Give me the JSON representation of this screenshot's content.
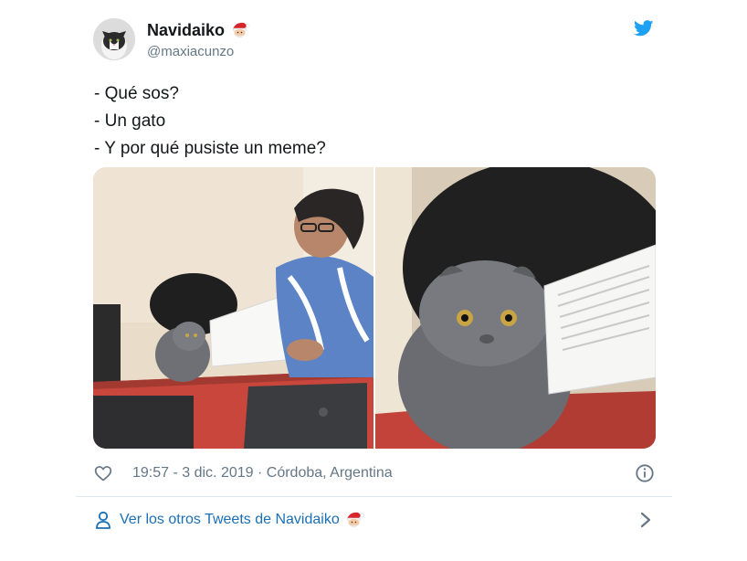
{
  "tweet": {
    "display_name": "Navidaiko",
    "name_emoji": "santa-emoji",
    "handle": "@maxiacunzo",
    "lines": [
      "- Qué sos?",
      "- Un gato",
      "- Y por qué pusiste un meme?"
    ],
    "media": {
      "left_photo": "woman-reading-papers-with-cat-photo",
      "right_photo": "cat-closeup-with-papers-photo"
    },
    "meta_text": "19:57 - 3 dic. 2019 · Córdoba, Argentina",
    "footer_text": "Ver los otros Tweets de Navidaiko"
  },
  "icons": {
    "like": "heart-icon",
    "info": "info-icon",
    "brand": "twitter-bird-icon",
    "profile": "person-icon",
    "next": "chevron-right-icon"
  },
  "colors": {
    "brand_blue": "#1da1f2",
    "link_blue": "#1b6fb5",
    "secondary_text": "#657786",
    "divider": "#e1e8ed"
  }
}
